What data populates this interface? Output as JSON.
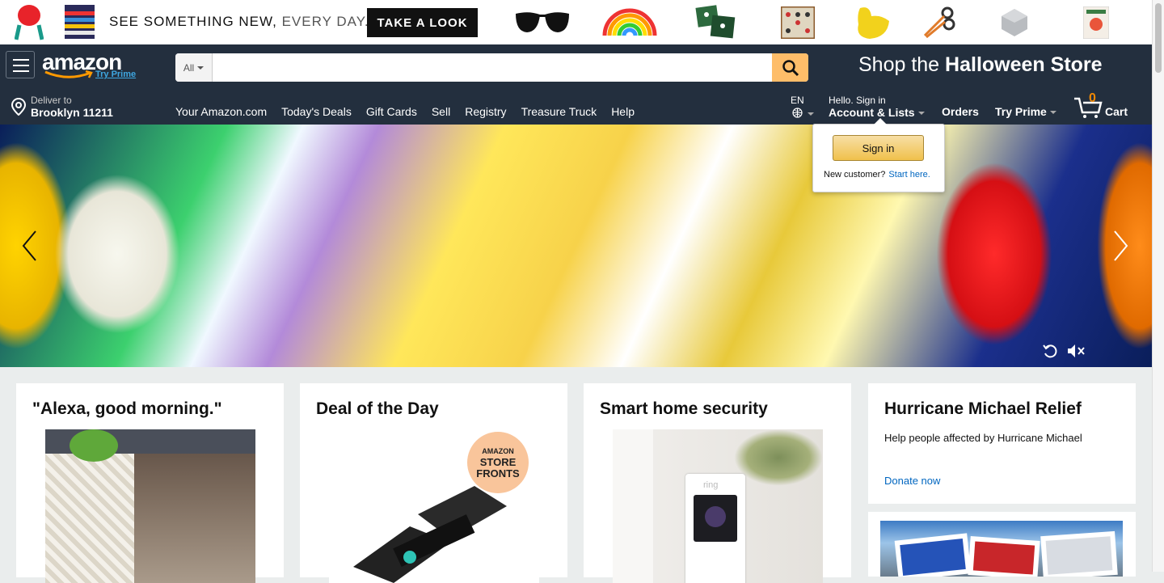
{
  "promo": {
    "tagline_a": "SEE SOMETHING NEW,",
    "tagline_b": "EVERY DAY.",
    "cta_label": "TAKE A LOOK",
    "products": [
      "balloon-icon",
      "blanket-icon",
      "sunglasses-icon",
      "rainbow-icon",
      "pillows-icon",
      "connect-four-icon",
      "duck-icon",
      "scissors-icon",
      "speaker-icon",
      "snack-box-icon"
    ]
  },
  "nav": {
    "logo_word": "amazon",
    "logo_sub": "Try Prime",
    "search": {
      "category": "All",
      "placeholder": "",
      "value": ""
    },
    "banner_pre": "Shop the",
    "banner_bold": "Halloween Store",
    "deliver_line1": "Deliver to",
    "deliver_line2": "Brooklyn 11211",
    "links": [
      "Your Amazon.com",
      "Today's Deals",
      "Gift Cards",
      "Sell",
      "Registry",
      "Treasure Truck",
      "Help"
    ],
    "lang": "EN",
    "account_line1": "Hello. Sign in",
    "account_line2": "Account & Lists",
    "orders": "Orders",
    "try_prime": "Try Prime",
    "cart_count": "0",
    "cart_label": "Cart"
  },
  "popover": {
    "signin_label": "Sign in",
    "new_customer": "New customer?",
    "start_here": "Start here."
  },
  "cards": [
    {
      "title": "\"Alexa, good morning.\""
    },
    {
      "title": "Deal of the Day",
      "badge": [
        "AMAZON",
        "STORE",
        "FRONTS"
      ]
    },
    {
      "title": "Smart home security",
      "brand": "ring"
    }
  ],
  "relief": {
    "title": "Hurricane Michael Relief",
    "subtitle": "Help people affected by Hurricane Michael",
    "link": "Donate now"
  },
  "colors": {
    "nav_bg": "#232f3e",
    "search_btn": "#febd69",
    "cart_count": "#f08804",
    "link": "#0066c0"
  }
}
